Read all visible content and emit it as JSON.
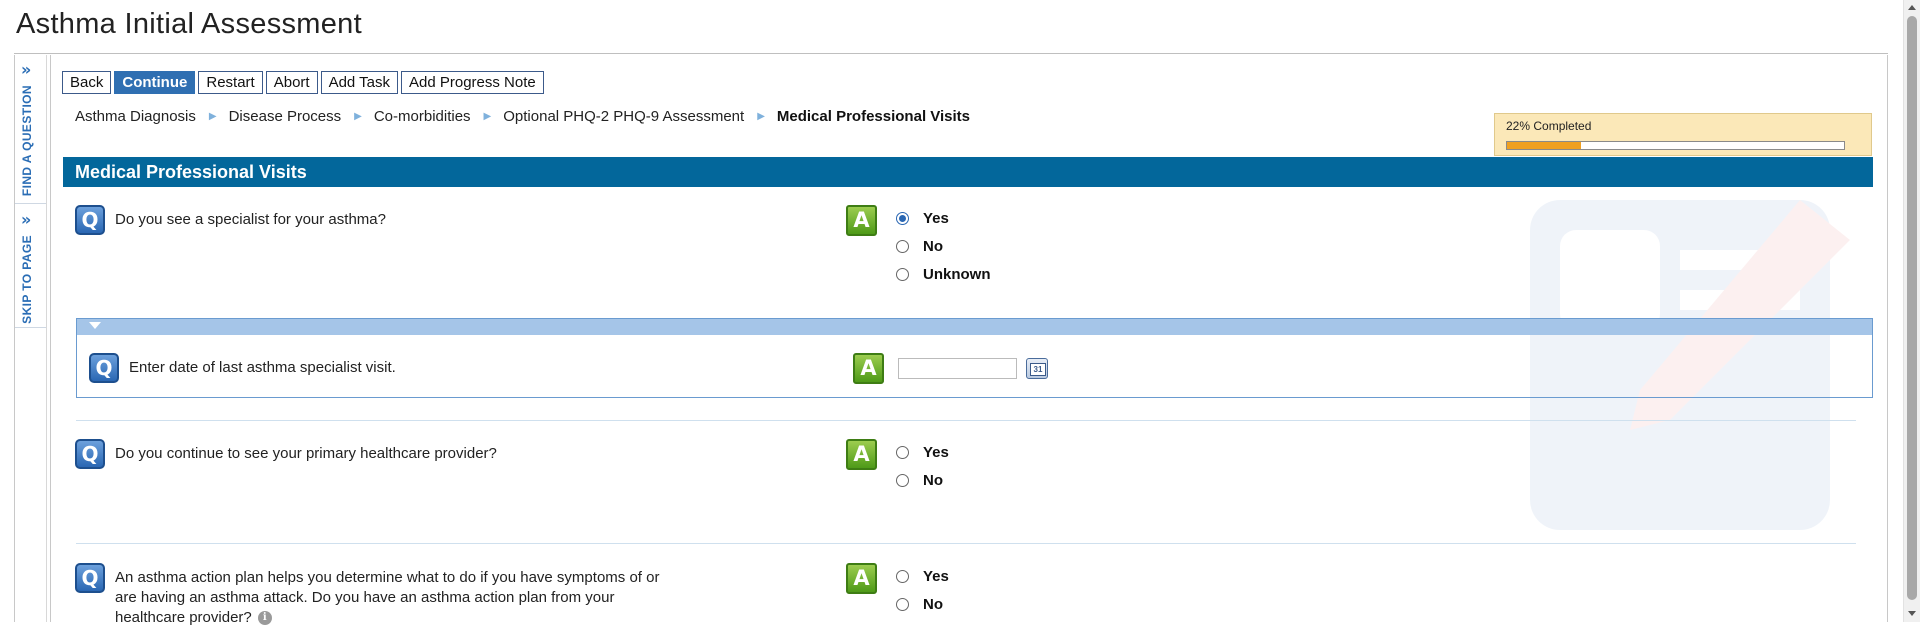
{
  "page": {
    "title": "Asthma Initial Assessment"
  },
  "sidebar": {
    "tabs": [
      {
        "chevron": "»",
        "label": "FIND A QUESTION"
      },
      {
        "chevron": "»",
        "label": "SKIP TO PAGE"
      }
    ]
  },
  "toolbar": {
    "back_label": "Back",
    "continue_label": "Continue",
    "restart_label": "Restart",
    "abort_label": "Abort",
    "add_task_label": "Add Task",
    "add_progress_note_label": "Add Progress Note"
  },
  "breadcrumb": {
    "items": [
      "Asthma Diagnosis",
      "Disease Process",
      "Co-morbidities",
      "Optional PHQ-2 PHQ-9 Assessment",
      "Medical Professional Visits"
    ]
  },
  "progress": {
    "label": "22% Completed",
    "fraction": 0.22
  },
  "section": {
    "title": "Medical Professional Visits"
  },
  "icons": {
    "question": "Q",
    "answer": "A",
    "calendar": "31",
    "info": "i",
    "collapse": "triangle-down-icon"
  },
  "questions": [
    {
      "text": "Do you see a specialist for your asthma?",
      "options": [
        "Yes",
        "No",
        "Unknown"
      ],
      "selected": "Yes"
    },
    {
      "text": "Enter date of last asthma specialist visit.",
      "date_value": ""
    },
    {
      "text": "Do you continue to see your primary healthcare provider?",
      "options": [
        "Yes",
        "No"
      ],
      "selected": null
    },
    {
      "text": "An asthma action plan helps you determine what to do if you have symptoms of or are having an asthma attack. Do you have an asthma action plan from your healthcare provider?",
      "options": [
        "Yes",
        "No"
      ],
      "selected": null
    }
  ],
  "colors": {
    "section_header": "#03679b",
    "primary_button": "#2f6fb2",
    "progress_fill": "#f0a020",
    "progress_box": "#fbe8b8",
    "subpanel_bar": "#a5c5e8"
  }
}
